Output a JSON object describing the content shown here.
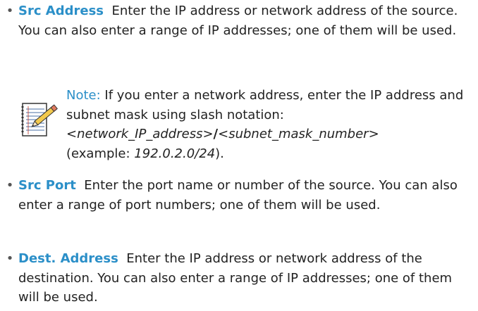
{
  "items": [
    {
      "term": "Src Address",
      "desc": "Enter the IP address or network address of the source. You can also enter a range of IP addresses; one of them will be used."
    },
    {
      "term": "Src Port",
      "desc": "Enter the port name or number of the source. You can also enter a range of port numbers; one of them will be used."
    },
    {
      "term": "Dest. Address",
      "desc": "Enter the IP address or network address of the destination. You can also enter a range of IP addresses; one of them will be used."
    }
  ],
  "bullet": "•",
  "note": {
    "label": "Note:",
    "text": "If you enter a network address, enter the IP address and subnet mask using slash notation:",
    "syntax_network": "<network_IP_address>",
    "syntax_slash": "/",
    "syntax_mask": "<subnet_mask_number>",
    "example_prefix": "(example: ",
    "example_value": "192.0.2.0/24",
    "example_suffix": ").",
    "icon": "notepad-pencil-icon"
  }
}
